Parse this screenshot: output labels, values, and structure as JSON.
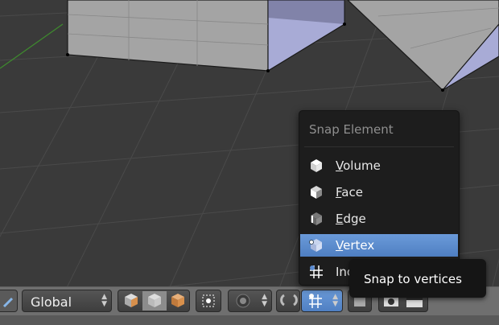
{
  "menu": {
    "title": "Snap Element",
    "items": [
      {
        "ul": "V",
        "rest": "olume",
        "icon": "volume-icon",
        "active": false
      },
      {
        "ul": "F",
        "rest": "ace",
        "icon": "face-icon",
        "active": false
      },
      {
        "ul": "E",
        "rest": "dge",
        "icon": "edge-icon",
        "active": false
      },
      {
        "ul": "V",
        "rest": "ertex",
        "icon": "vertex-icon",
        "active": true
      },
      {
        "ul": "",
        "rest": "Increment",
        "icon": "increment-icon",
        "active": false
      }
    ]
  },
  "tooltip": {
    "text": "Snap to vertices"
  },
  "header": {
    "orientation_value": "Global"
  },
  "colors": {
    "viewport_bg": "#3a3a3a",
    "menu_bg": "#1d1d1d",
    "highlight": "#5b8bd0",
    "mesh_face": "#a5a5a5",
    "mesh_selected": "#aeb1d9"
  }
}
